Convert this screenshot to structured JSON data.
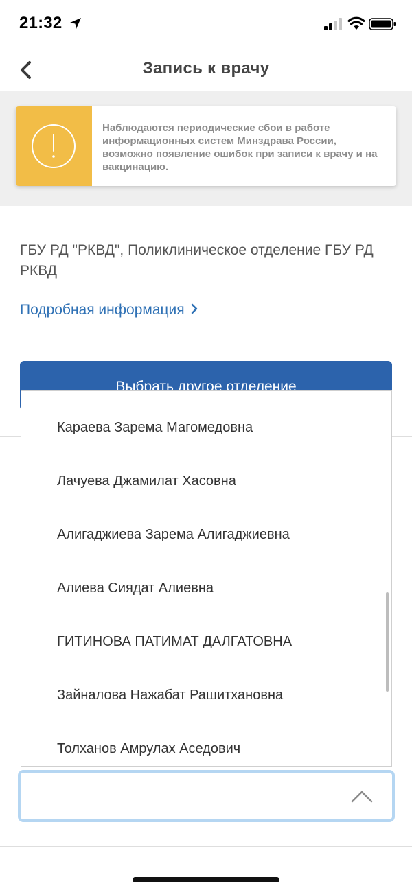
{
  "status_bar": {
    "time": "21:32"
  },
  "nav": {
    "title": "Запись к врачу"
  },
  "notice": {
    "text": "Наблюдаются периодические сбои в работе информационных систем Минздрава России, возможно появление ошибок при записи к врачу и на вакцинацию.",
    "accent_color": "#f2bd47"
  },
  "clinic": {
    "name": "ГБУ РД \"РКВД\", Поликлиническое отделение ГБУ РД РКВД",
    "details_link": "Подробная информация"
  },
  "choose_department_button": {
    "label": "Выбрать другое отделение",
    "color": "#2c63ac"
  },
  "doctor_list": {
    "items": [
      "Караева Зарема Магомедовна",
      "Лачуева Джамилат Хасовна",
      "Алигаджиева Зарема Алигаджиевна",
      "Алиева Сиядат Алиевна",
      "ГИТИНОВА ПАТИМАТ ДАЛГАТОВНА",
      "Зайналова Нажабат Рашитхановна",
      "Толханов Амрулах Аседович"
    ]
  },
  "select_field": {
    "value": ""
  }
}
